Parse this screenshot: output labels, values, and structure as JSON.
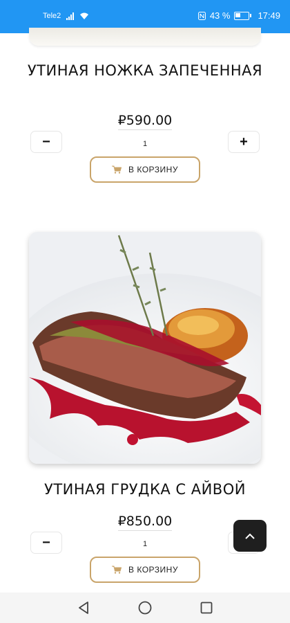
{
  "status_bar": {
    "carrier": "Tele2",
    "battery": "43 %",
    "time": "17:49"
  },
  "products": [
    {
      "title": "УТИНАЯ НОЖКА ЗАПЕЧЕННАЯ",
      "price": "₽590.00",
      "quantity": "1",
      "minus_label": "−",
      "plus_label": "+",
      "cart_label": "В КОРЗИНУ"
    },
    {
      "title": "УТИНАЯ ГРУДКА С АЙВОЙ",
      "price": "₽850.00",
      "quantity": "1",
      "minus_label": "−",
      "plus_label": "+",
      "cart_label": "В КОРЗИНУ"
    }
  ],
  "colors": {
    "status_bar": "#2196f3",
    "accent_border": "#c9a46a",
    "fab_bg": "#1f1f1f"
  },
  "icons": [
    "signal-icon",
    "wifi-icon",
    "nfc-icon",
    "battery-icon",
    "cart-icon",
    "chevron-up-icon",
    "back-icon",
    "home-icon",
    "recents-icon"
  ]
}
